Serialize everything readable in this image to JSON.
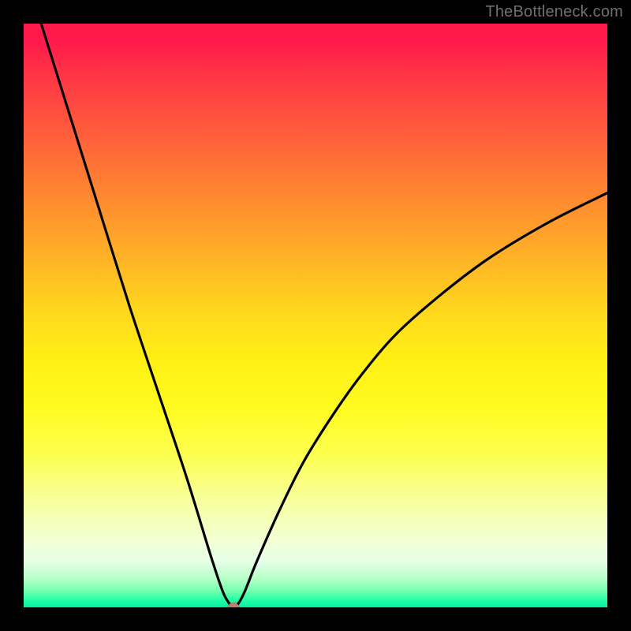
{
  "watermark": "TheBottleneck.com",
  "colors": {
    "background": "#000000",
    "curve": "#000000",
    "marker": "#c47a6a",
    "gradient_top": "#ff1a4b",
    "gradient_mid": "#fff014",
    "gradient_bottom": "#00f0a0"
  },
  "chart_data": {
    "type": "line",
    "title": "",
    "xlabel": "",
    "ylabel": "",
    "xlim": [
      0,
      100
    ],
    "ylim": [
      0,
      100
    ],
    "grid": false,
    "legend": false,
    "series": [
      {
        "name": "bottleneck-curve",
        "x": [
          3,
          8,
          13,
          18,
          23,
          28,
          32,
          34,
          35,
          36,
          37,
          38,
          40,
          44,
          48,
          53,
          58,
          64,
          72,
          80,
          90,
          100
        ],
        "y": [
          100,
          84,
          68,
          52,
          37,
          22,
          9,
          3,
          1,
          0,
          1,
          3,
          8,
          17,
          25,
          33,
          40,
          47,
          54,
          60,
          66,
          71
        ]
      }
    ],
    "marker": {
      "x": 36,
      "y": 0
    }
  }
}
